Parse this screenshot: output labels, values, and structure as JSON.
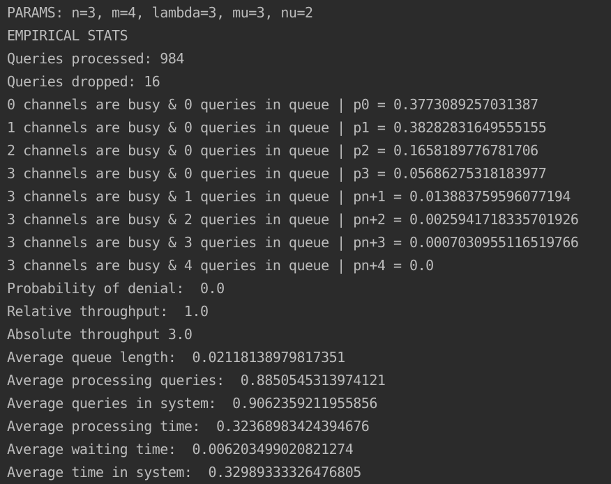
{
  "console": {
    "lines": [
      "PARAMS: n=3, m=4, lambda=3, mu=3, nu=2",
      "EMPIRICAL STATS",
      "Queries processed: 984",
      "Queries dropped: 16",
      "0 channels are busy & 0 queries in queue | p0 = 0.3773089257031387",
      "1 channels are busy & 0 queries in queue | p1 = 0.38282831649555155",
      "2 channels are busy & 0 queries in queue | p2 = 0.1658189776781706",
      "3 channels are busy & 0 queries in queue | p3 = 0.05686275318183977",
      "3 channels are busy & 1 queries in queue | pn+1 = 0.013883759596077194",
      "3 channels are busy & 2 queries in queue | pn+2 = 0.0025941718335701926",
      "3 channels are busy & 3 queries in queue | pn+3 = 0.0007030955116519766",
      "3 channels are busy & 4 queries in queue | pn+4 = 0.0",
      "Probability of denial:  0.0",
      "Relative throughput:  1.0",
      "Absolute throughput 3.0",
      "Average queue length:  0.02118138979817351",
      "Average processing queries:  0.8850545313974121",
      "Average queries in system:  0.9062359211955856",
      "Average processing time:  0.32368983424394676",
      "Average waiting time:  0.006203499020821274",
      "Average time in system:  0.32989333326476805"
    ]
  },
  "colors": {
    "background": "#2b2b2b",
    "text": "#bbbbbb"
  }
}
